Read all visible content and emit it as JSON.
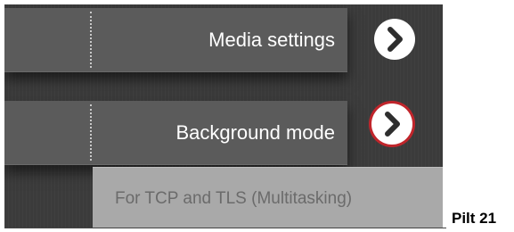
{
  "settings": {
    "rows": [
      {
        "label": "Media settings"
      },
      {
        "label": "Background mode"
      }
    ],
    "background_mode_value": "For TCP and TLS (Multitasking)"
  },
  "icons": {
    "row_chevron": "chevron-right-icon"
  },
  "colors": {
    "highlight_ring": "#c0252b",
    "row_background": "#5b5b5b",
    "selected_value_background": "#a9a9a9"
  },
  "caption": "Pilt 21"
}
